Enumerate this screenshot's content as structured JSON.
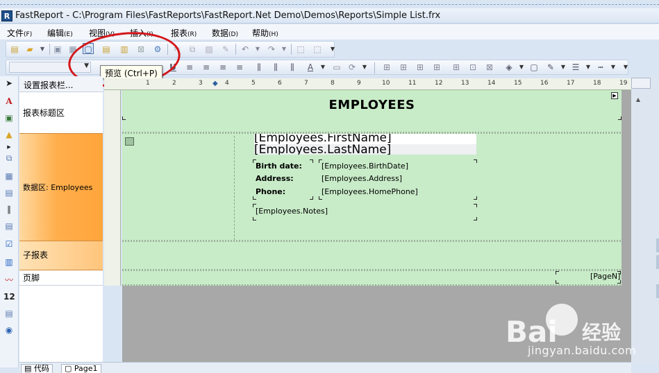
{
  "window": {
    "title": "FastReport - C:\\Program Files\\FastReports\\FastReport.Net Demo\\Demos\\Reports\\Simple List.frx",
    "app_icon_letter": "R"
  },
  "menu": [
    {
      "label": "文件",
      "acc": "(F)"
    },
    {
      "label": "编辑",
      "acc": "(E)"
    },
    {
      "label": "视图",
      "acc": "(V)"
    },
    {
      "label": "插入",
      "acc": "(I)"
    },
    {
      "label": "报表",
      "acc": "(R)"
    },
    {
      "label": "数据",
      "acc": "(D)"
    },
    {
      "label": "帮助",
      "acc": "(H)"
    }
  ],
  "tooltip": "预览 (Ctrl+P)",
  "band_panel": {
    "title": "设置报表栏...",
    "bands": {
      "report_title": "报表标题区",
      "data": "数据区: Employees",
      "child": "子报表",
      "footer": "页脚"
    }
  },
  "ruler": {
    "numbers": [
      "1",
      "2",
      "3",
      "4",
      "5",
      "6",
      "7",
      "8",
      "9",
      "10",
      "11",
      "12",
      "13",
      "14",
      "15",
      "16",
      "17",
      "18",
      "19"
    ]
  },
  "report": {
    "title": "EMPLOYEES",
    "firstname": "[Employees.FirstName]",
    "lastname": "[Employees.LastName]",
    "labels": {
      "birth": "Birth date:",
      "address": "Address:",
      "phone": "Phone:"
    },
    "values": {
      "birth": "[Employees.BirthDate]",
      "address": "[Employees.Address]",
      "phone": "[Employees.HomePhone]"
    },
    "notes": "[Employees.Notes]",
    "page_number": "[PageN]"
  },
  "tabs": {
    "code": "代码",
    "page": "Page1"
  },
  "watermark": {
    "brand": "Bai",
    "product": "经验",
    "url": "jingyan.baidu.com"
  },
  "colors": {
    "band_green": "#c8ebc8",
    "data_band_orange": "#ffa53b",
    "highlight_circle": "#d4161a"
  }
}
